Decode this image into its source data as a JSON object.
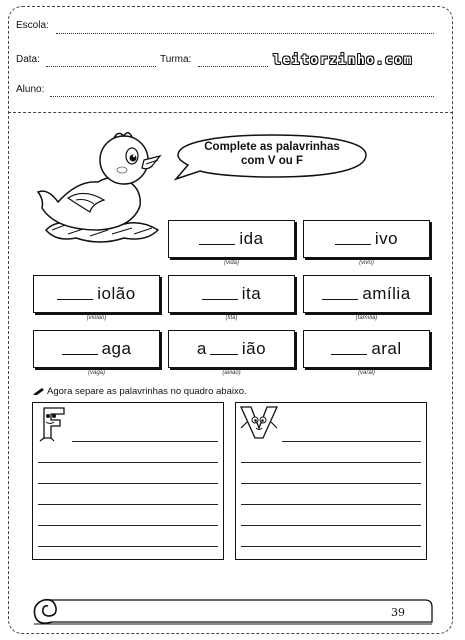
{
  "header": {
    "school_label": "Escola:",
    "date_label": "Data:",
    "class_label": "Turma:",
    "student_label": "Aluno:",
    "brand": "leitorzinho.com"
  },
  "speech": {
    "line1": "Complete as palavrinhas",
    "line2": "com V ou F"
  },
  "exercises": [
    {
      "prefix": "",
      "suffix": "ida",
      "hint": "(vida)"
    },
    {
      "prefix": "",
      "suffix": "ivo",
      "hint": "(vivo)"
    },
    {
      "prefix": "",
      "suffix": "iolão",
      "hint": "(violão)"
    },
    {
      "prefix": "",
      "suffix": "ita",
      "hint": "(fita)"
    },
    {
      "prefix": "",
      "suffix": "amília",
      "hint": "(família)"
    },
    {
      "prefix": "",
      "suffix": "aga",
      "hint": "(vaga)"
    },
    {
      "prefix": "a",
      "suffix": "ião",
      "hint": "(avião)"
    },
    {
      "prefix": "",
      "suffix": "aral",
      "hint": "(varal)"
    }
  ],
  "instruction": "Agora separe as palavrinhas no quadro abaixo.",
  "columns": {
    "left_letter": "F",
    "right_letter": "V"
  },
  "page_number": "39",
  "icons": [
    "chick-icon",
    "pencil-icon",
    "letter-f-icon",
    "letter-v-icon",
    "scroll-icon"
  ]
}
